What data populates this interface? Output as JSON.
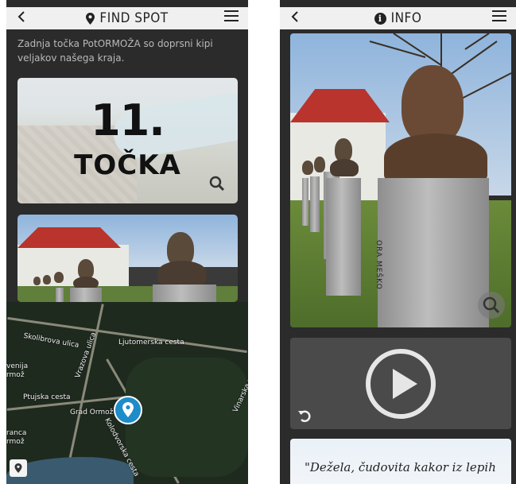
{
  "left_screen": {
    "header": {
      "back_icon": "chevron-left-icon",
      "title_icon": "map-pin-icon",
      "title": "FIND SPOT",
      "menu_icon": "hamburger-menu-icon"
    },
    "intro_text": "Zadnja točka PotORMOŽA so doprsni kipi veljakov našega kraja.",
    "card_point": {
      "number": "11.",
      "word": "TOČKA",
      "zoom_icon": "magnifier-icon"
    },
    "map": {
      "labels": {
        "skolibrova": "Skolibrova ulica",
        "vrazova": "Vrazova ulica",
        "ljutomerska": "Ljutomerska cesta",
        "ptujska": "Ptujska cesta",
        "grad": "Grad Ormož",
        "vinarska": "Vinarska ulica",
        "kolodvorska": "Kolodvorska cesta",
        "left_top_1": "venija",
        "left_top_2": "rmož",
        "left_bottom_1": "ranca",
        "left_bottom_2": "rmož"
      },
      "marker_icon": "location-pin-icon",
      "locate_button_icon": "location-pin-icon"
    }
  },
  "right_screen": {
    "header": {
      "back_icon": "chevron-left-icon",
      "title_icon": "info-icon",
      "title": "INFO",
      "menu_icon": "hamburger-menu-icon"
    },
    "photo": {
      "plaque_text": "ORA MEŠKO",
      "zoom_icon": "magnifier-icon"
    },
    "video": {
      "play_icon": "play-icon",
      "replay_icon": "replay-icon"
    },
    "quote": {
      "text": "\"Dežela, čudovita kakor iz lepih"
    }
  },
  "colors": {
    "app_background": "#2b2b2b",
    "header_background": "#f0f0f0",
    "marker": "#1e8cc8",
    "roof": "#b8342d"
  }
}
